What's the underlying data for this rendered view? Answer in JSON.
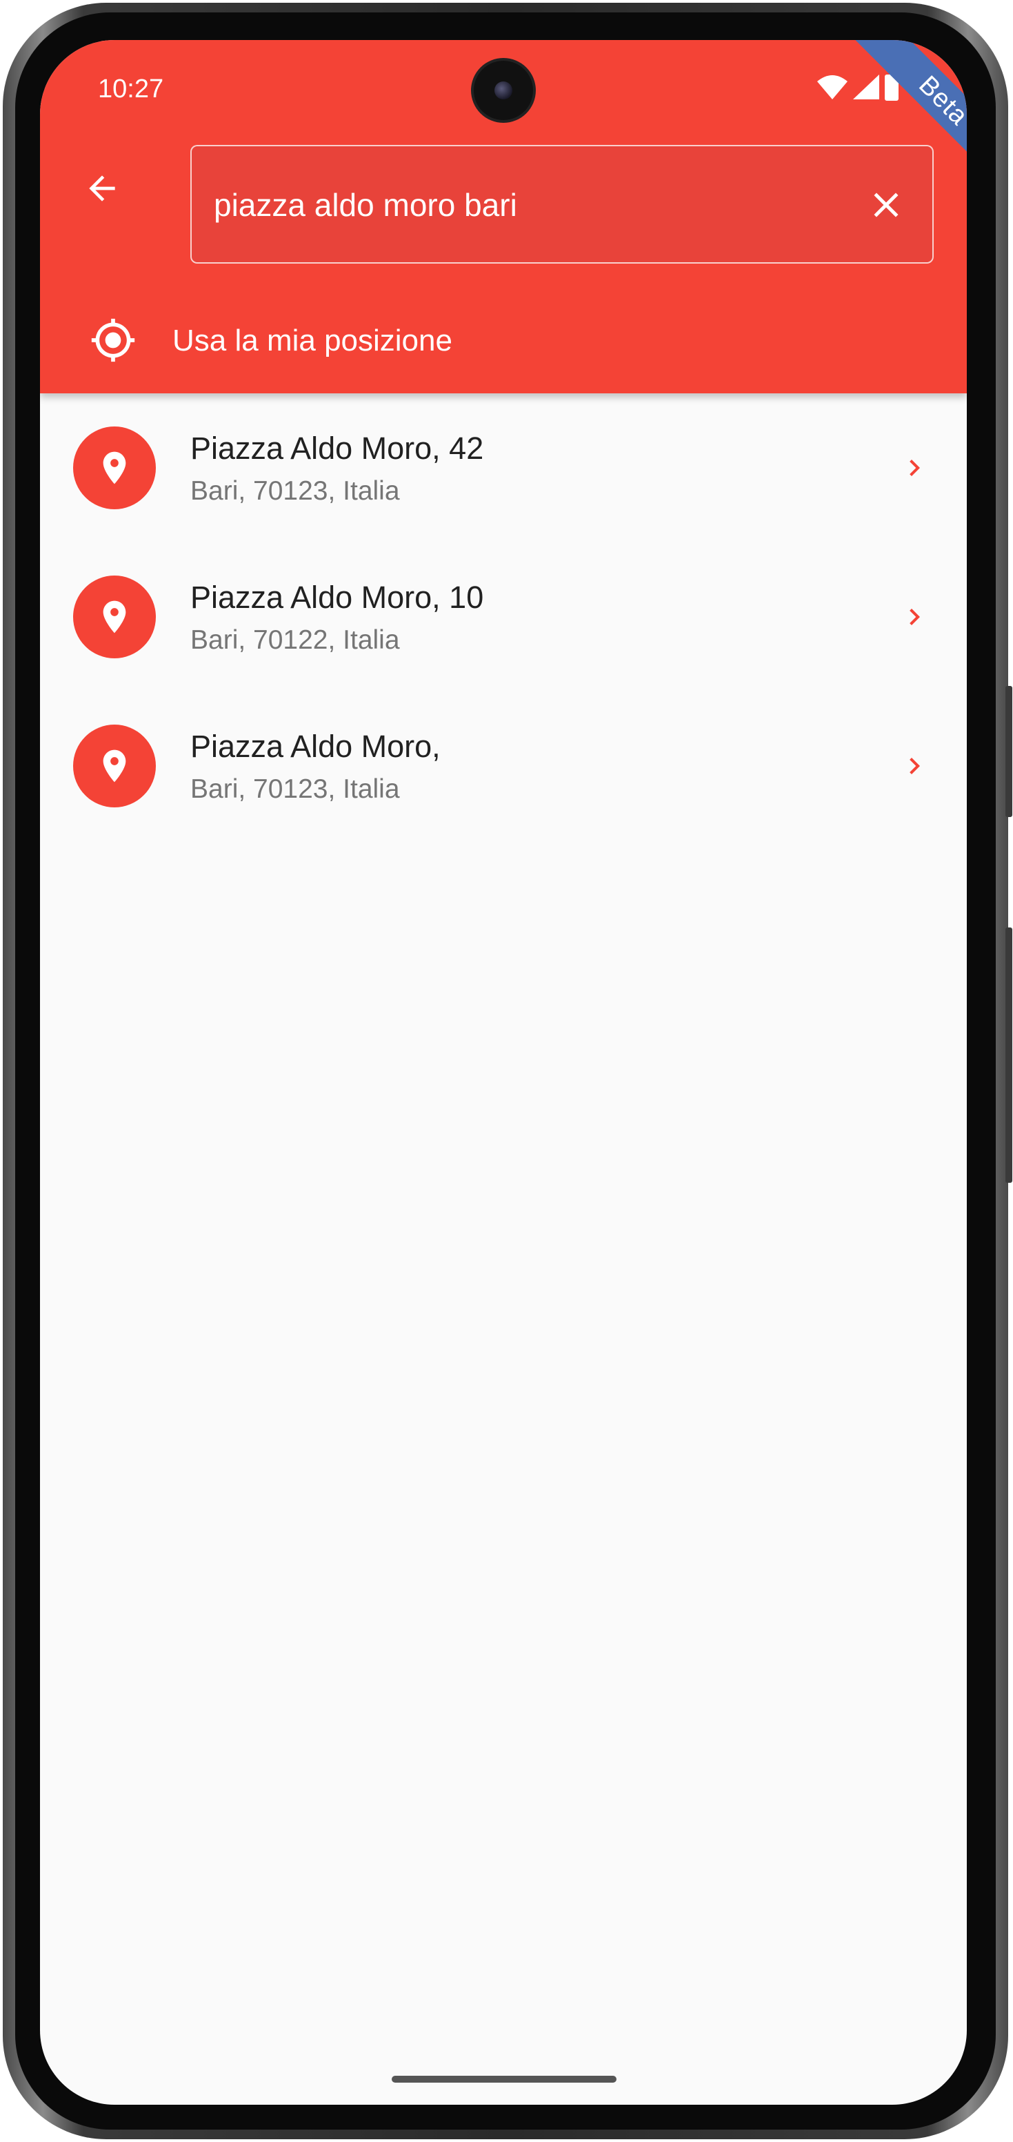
{
  "status_bar": {
    "time": "10:27",
    "icons": [
      "wifi-icon",
      "signal-icon",
      "battery-icon"
    ]
  },
  "ribbon": {
    "label": "Beta",
    "color": "#4a6fb5"
  },
  "colors": {
    "primary": "#f44336",
    "background": "#fafafa",
    "title_text": "#212121",
    "subtitle_text": "#757575"
  },
  "search": {
    "value": "piazza aldo moro bari",
    "back_icon": "arrow-left-icon",
    "clear_icon": "close-icon"
  },
  "use_location": {
    "label": "Usa la mia posizione",
    "icon": "gps-target-icon"
  },
  "results": [
    {
      "title": "Piazza Aldo Moro, 42",
      "subtitle": "Bari, 70123, Italia",
      "icon": "location-pin-icon"
    },
    {
      "title": "Piazza Aldo Moro, 10",
      "subtitle": "Bari, 70122, Italia",
      "icon": "location-pin-icon"
    },
    {
      "title": "Piazza Aldo Moro,",
      "subtitle": "Bari, 70123, Italia",
      "icon": "location-pin-icon"
    }
  ]
}
